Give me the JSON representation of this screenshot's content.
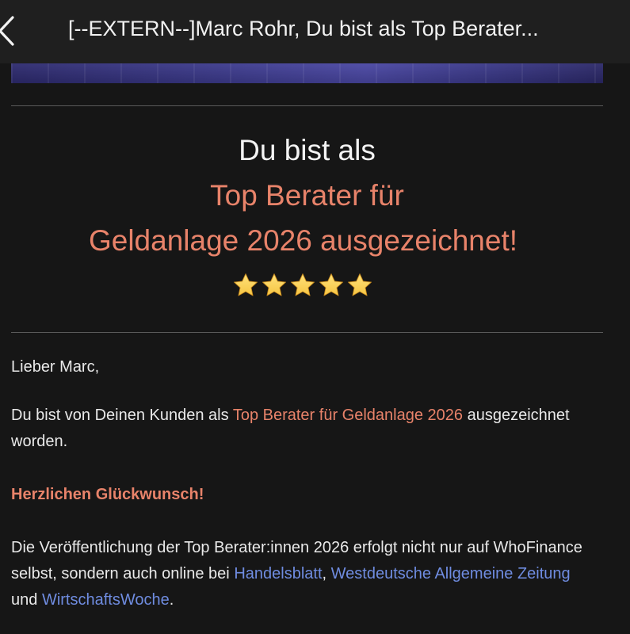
{
  "topbar": {
    "back_icon": "chevron-left-icon",
    "title": "[--EXTERN--]Marc Rohr, Du bist als Top Berater..."
  },
  "email": {
    "headline": {
      "line1": "Du bist als",
      "line2": "Top Berater für",
      "line3": "Geldanlage 2026 ausgezeichnet!"
    },
    "rating": {
      "stars": 5,
      "star_icon": "star-icon",
      "star_color": "#f6c543"
    },
    "greeting": "Lieber Marc,",
    "para1": {
      "text_before": "Du bist von Deinen Kunden als ",
      "highlight": "Top Berater für Geldanlage 2026",
      "text_after": " ausgezeichnet worden."
    },
    "congrats": "Herzlichen Glückwunsch!",
    "para2": {
      "text_before": "Die Veröffentlichung der Top Berater:innen 2026 erfolgt nicht nur auf WhoFinance selbst, sondern auch online bei ",
      "link1": "Handelsblatt",
      "sep1": ", ",
      "link2": "Westdeutsche Allgemeine Zeitung",
      "sep2": " und ",
      "link3": "WirtschaftsWoche",
      "end": "."
    }
  },
  "colors": {
    "background": "#161616",
    "accent": "#e8836a",
    "link": "#6f8ce0",
    "text": "#e9e9e9"
  }
}
